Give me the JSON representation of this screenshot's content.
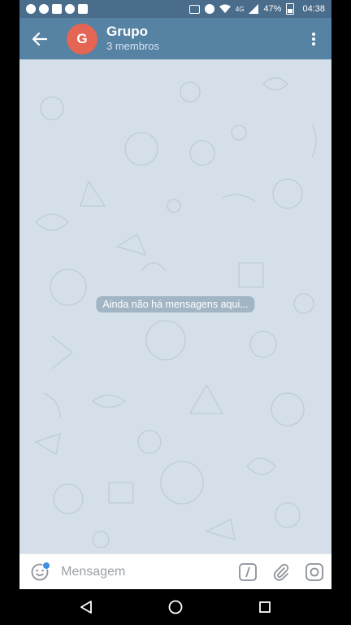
{
  "status_bar": {
    "network": "4G",
    "battery": "47%",
    "time": "04:38"
  },
  "header": {
    "avatar_letter": "G",
    "title": "Grupo",
    "subtitle": "3 membros"
  },
  "chat": {
    "empty_message": "Ainda não há mensagens aqui..."
  },
  "input": {
    "placeholder": "Mensagem"
  },
  "colors": {
    "header": "#5682a3",
    "status_bar": "#4a6d8c",
    "avatar": "#e56555",
    "chat_background": "#d4dfe9"
  }
}
